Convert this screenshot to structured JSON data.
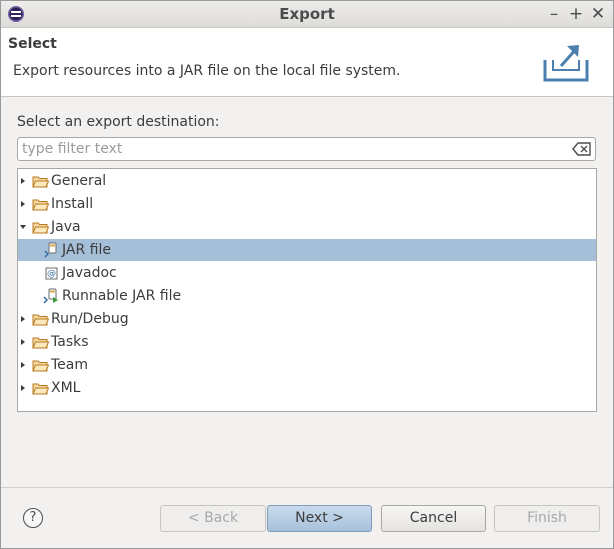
{
  "window": {
    "title": "Export"
  },
  "header": {
    "title": "Select",
    "description": "Export resources into a JAR file on the local file system."
  },
  "destination": {
    "label": "Select an export destination:",
    "filter_placeholder": "type filter text",
    "filter_value": ""
  },
  "tree": {
    "items": [
      {
        "label": "General",
        "type": "folder",
        "expanded": false
      },
      {
        "label": "Install",
        "type": "folder",
        "expanded": false
      },
      {
        "label": "Java",
        "type": "folder",
        "expanded": true
      },
      {
        "label": "JAR file",
        "type": "leaf",
        "icon": "jar-file-icon",
        "selected": true
      },
      {
        "label": "Javadoc",
        "type": "leaf",
        "icon": "javadoc-icon"
      },
      {
        "label": "Runnable JAR file",
        "type": "leaf",
        "icon": "runnable-jar-icon"
      },
      {
        "label": "Run/Debug",
        "type": "folder",
        "expanded": false
      },
      {
        "label": "Tasks",
        "type": "folder",
        "expanded": false
      },
      {
        "label": "Team",
        "type": "folder",
        "expanded": false
      },
      {
        "label": "XML",
        "type": "folder",
        "expanded": false
      }
    ]
  },
  "buttons": {
    "help": "?",
    "back": "< Back",
    "next": "Next >",
    "cancel": "Cancel",
    "finish": "Finish"
  },
  "colors": {
    "selection": "#a5bfd8",
    "folder": "#e3a33c",
    "default_button": "#b4cbe3"
  }
}
